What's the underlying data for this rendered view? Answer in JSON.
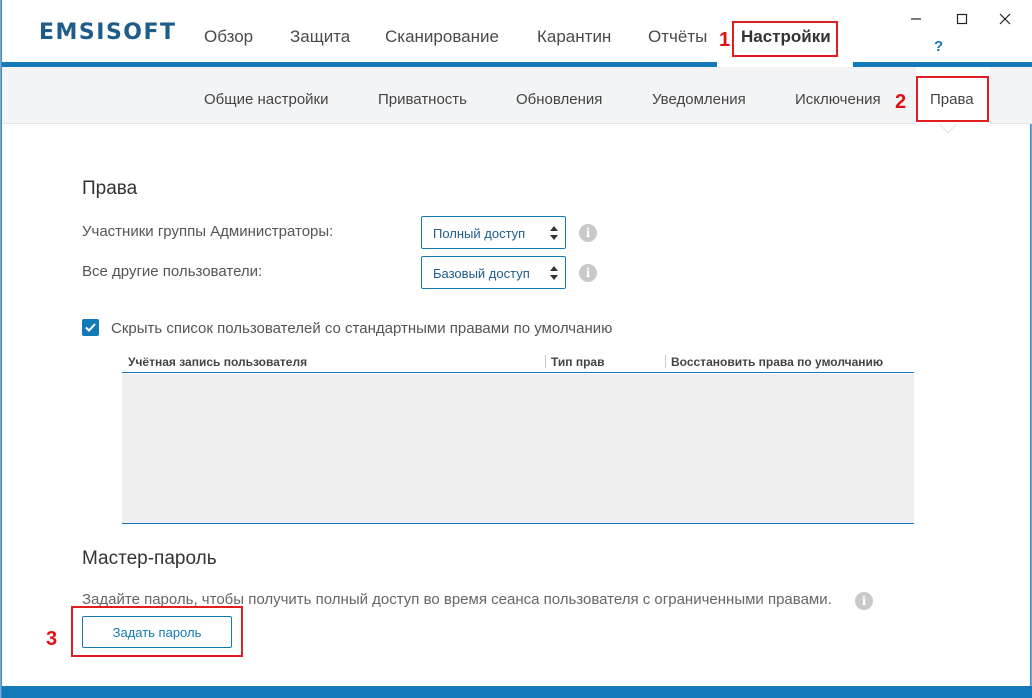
{
  "app": {
    "logo": "EMSISOFT"
  },
  "nav": {
    "items": [
      {
        "label": "Обзор"
      },
      {
        "label": "Защита"
      },
      {
        "label": "Сканирование"
      },
      {
        "label": "Карантин"
      },
      {
        "label": "Отчёты"
      },
      {
        "label": "Настройки"
      }
    ],
    "help": "?"
  },
  "window_controls": {
    "minimize": "—",
    "maximize": "☐",
    "close": "✕"
  },
  "subnav": {
    "items": [
      {
        "label": "Общие настройки"
      },
      {
        "label": "Приватность"
      },
      {
        "label": "Обновления"
      },
      {
        "label": "Уведомления"
      },
      {
        "label": "Исключения"
      },
      {
        "label": "Права"
      }
    ]
  },
  "callouts": {
    "one": "1",
    "two": "2",
    "three": "3"
  },
  "rights": {
    "title": "Права",
    "admins_label": "Участники группы Администраторы:",
    "admins_value": "Полный доступ",
    "others_label": "Все другие пользователи:",
    "others_value": "Базовый доступ",
    "hide_list_label": "Скрыть список пользователей со стандартными правами по умолчанию",
    "hide_list_checked": true,
    "table": {
      "columns": [
        "Учётная запись пользователя",
        "Тип прав",
        "Восстановить права по умолчанию"
      ],
      "rows": []
    }
  },
  "master_password": {
    "title": "Мастер-пароль",
    "description": "Задайте пароль, чтобы получить полный доступ во время сеанса пользователя с ограниченными правами.",
    "button": "Задать пароль"
  },
  "colors": {
    "accent": "#1479b8",
    "callout": "#e02020",
    "logo": "#1e5c8a"
  }
}
